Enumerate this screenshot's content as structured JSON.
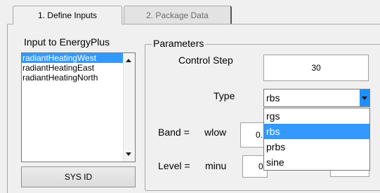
{
  "tabs": [
    {
      "label": "1. Define Inputs",
      "active": true
    },
    {
      "label": "2. Package Data",
      "active": false
    }
  ],
  "inputs": {
    "title": "Input to EnergyPlus",
    "items": [
      "radiantHeatingWest",
      "radiantHeatingEast",
      "radiantHeatingNorth"
    ],
    "selected": "radiantHeatingWest",
    "button_label": "SYS ID"
  },
  "parameters": {
    "title": "Parameters",
    "control_step_label": "Control Step",
    "control_step_value": "30",
    "type_label": "Type",
    "type_value": "rbs",
    "type_options": [
      "rgs",
      "rbs",
      "prbs",
      "sine"
    ],
    "band_label": "Band =",
    "wlow_label": "wlow",
    "wlow_value": "0.",
    "level_label": "Level =",
    "minu_label": "minu",
    "minu_value": "0",
    "right_value": "-"
  },
  "colors": {
    "selection": "#3399ff",
    "dropdown_arrow_bg": "#1e90ff",
    "background": "#f0f0f0"
  }
}
